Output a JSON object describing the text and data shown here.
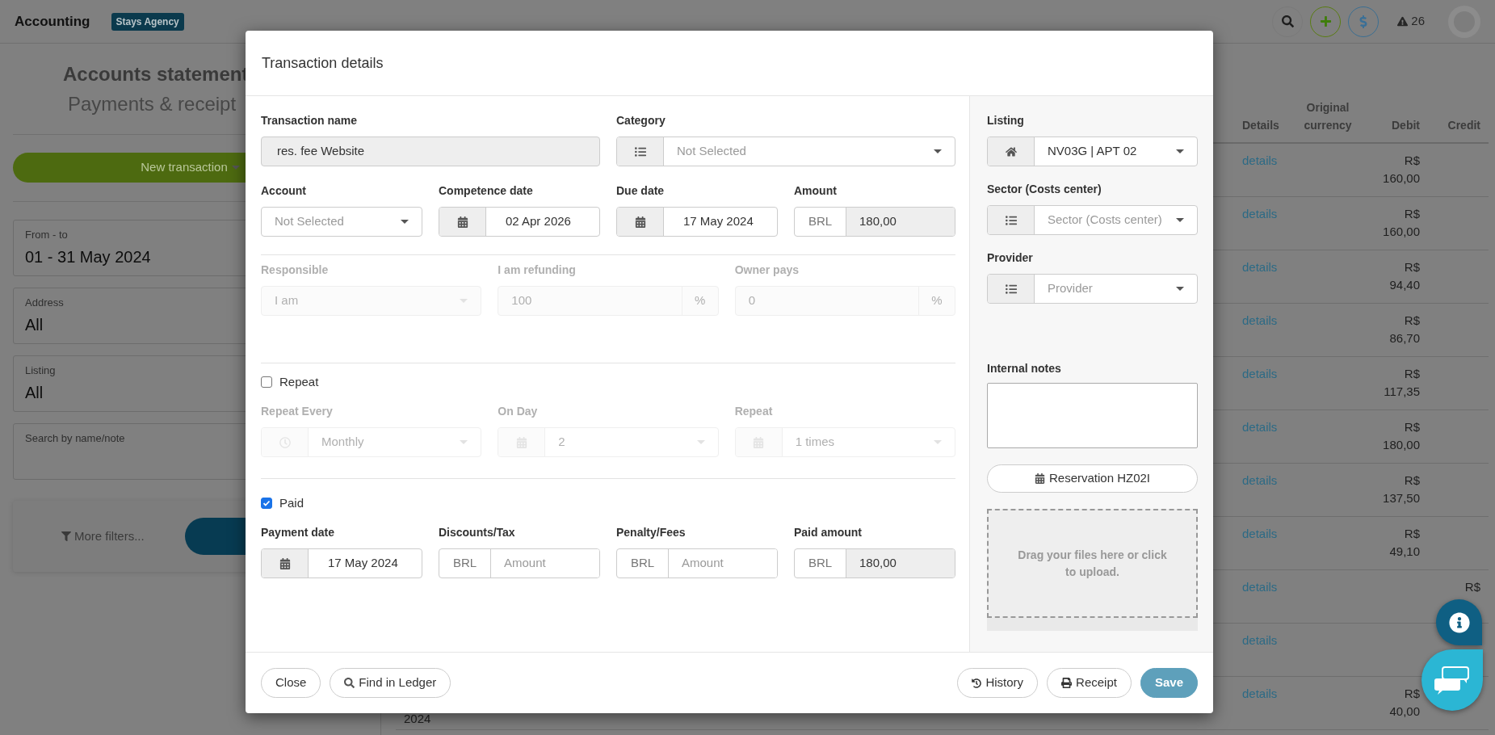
{
  "app_bar": {
    "title": "Accounting",
    "badge": "Stays Agency",
    "alert_count": "26"
  },
  "sidebar": {
    "title": "Accounts statement",
    "subtitle": "Payments & receipt",
    "new_transaction": "New transaction",
    "filters": [
      {
        "label": "From - to",
        "value": "01 - 31 May 2024"
      },
      {
        "label": "Address",
        "value": "All"
      },
      {
        "label": "Listing",
        "value": "All"
      },
      {
        "label": "Search by name/note"
      }
    ],
    "more_filters": "More filters..."
  },
  "table": {
    "columns": [
      "Details",
      "Original currency",
      "Debit",
      "Credit"
    ],
    "rows": [
      {
        "details": "details",
        "debit": "R$ 160,00"
      },
      {
        "details": "details",
        "debit": "R$ 160,00"
      },
      {
        "details": "details",
        "debit": "R$ 94,40"
      },
      {
        "details": "details",
        "debit": "R$ 86,70"
      },
      {
        "details": "details",
        "debit": "R$ 117,35"
      },
      {
        "details": "details",
        "debit": "R$ 180,00"
      },
      {
        "details": "details",
        "debit": "R$ 137,50"
      },
      {
        "details": "details",
        "debit": "R$ 49,10"
      },
      {
        "details": "details",
        "credit": "R$"
      },
      {
        "details": "details"
      },
      {
        "column_1": "2024",
        "details": "details",
        "debit": "R$ 40,00"
      }
    ]
  },
  "modal": {
    "title": "Transaction details",
    "rows": [
      {
        "fields": [
          {
            "kind": "text",
            "label": "Transaction name",
            "value": "res. fee Website",
            "readonly": true
          },
          {
            "kind": "list-select",
            "label": "Category",
            "placeholder": "Not Selected"
          }
        ]
      },
      {
        "fields": [
          {
            "kind": "select",
            "label": "Account",
            "placeholder": "Not Selected"
          },
          {
            "kind": "date",
            "label": "Competence date",
            "value": "02 Apr 2026"
          },
          {
            "kind": "date",
            "label": "Due date",
            "value": "17 May 2024"
          },
          {
            "kind": "money",
            "label": "Amount",
            "currency": "BRL",
            "value": "180,00",
            "readonly": true
          }
        ]
      }
    ],
    "split": {
      "disabled": true,
      "fields": [
        {
          "kind": "select",
          "label": "Responsible",
          "value": "I am"
        },
        {
          "kind": "percent",
          "label": "I am refunding",
          "value": "100",
          "unit": "%"
        },
        {
          "kind": "percent",
          "label": "Owner pays",
          "value": "0",
          "unit": "%"
        }
      ]
    },
    "repeat": {
      "label": "Repeat",
      "checked": false,
      "disabled": true,
      "fields": [
        {
          "kind": "clock-select",
          "label": "Repeat Every",
          "value": "Monthly"
        },
        {
          "kind": "calendar-select",
          "label": "On Day",
          "value": "2"
        },
        {
          "kind": "calendar-select",
          "label": "Repeat",
          "value": "1 times"
        }
      ]
    },
    "paid": {
      "label": "Paid",
      "checked": true,
      "disabled": false,
      "fields": [
        {
          "kind": "date",
          "label": "Payment date",
          "value": "17 May 2024"
        },
        {
          "kind": "money",
          "label": "Discounts/Tax",
          "currency": "BRL",
          "placeholder": "Amount",
          "readonly": false
        },
        {
          "kind": "money",
          "label": "Penalty/Fees",
          "currency": "BRL",
          "placeholder": "Amount",
          "readonly": false
        },
        {
          "kind": "money",
          "label": "Paid amount",
          "currency": "BRL",
          "value": "180,00",
          "readonly": true
        }
      ]
    },
    "side": {
      "fields": [
        {
          "kind": "home-select",
          "label": "Listing",
          "value": "NV03G | APT 02"
        },
        {
          "kind": "list-select",
          "label": "Sector (Costs center)",
          "placeholder": "Sector (Costs center)"
        },
        {
          "kind": "list-select",
          "label": "Provider",
          "placeholder": "Provider"
        }
      ],
      "notes_label": "Internal notes",
      "reservation": "Reservation HZ02I",
      "dropzone": "Drag your files here or click to upload."
    },
    "footer_left": [
      {
        "kind": "close",
        "label": "Close"
      },
      {
        "kind": "find",
        "label": "Find in Ledger"
      }
    ],
    "footer_right": [
      {
        "kind": "history",
        "label": "History"
      },
      {
        "kind": "receipt",
        "label": "Receipt"
      },
      {
        "kind": "save",
        "label": "Save"
      }
    ]
  },
  "floating_buttons": [
    {
      "kind": "info"
    },
    {
      "kind": "chat"
    }
  ]
}
